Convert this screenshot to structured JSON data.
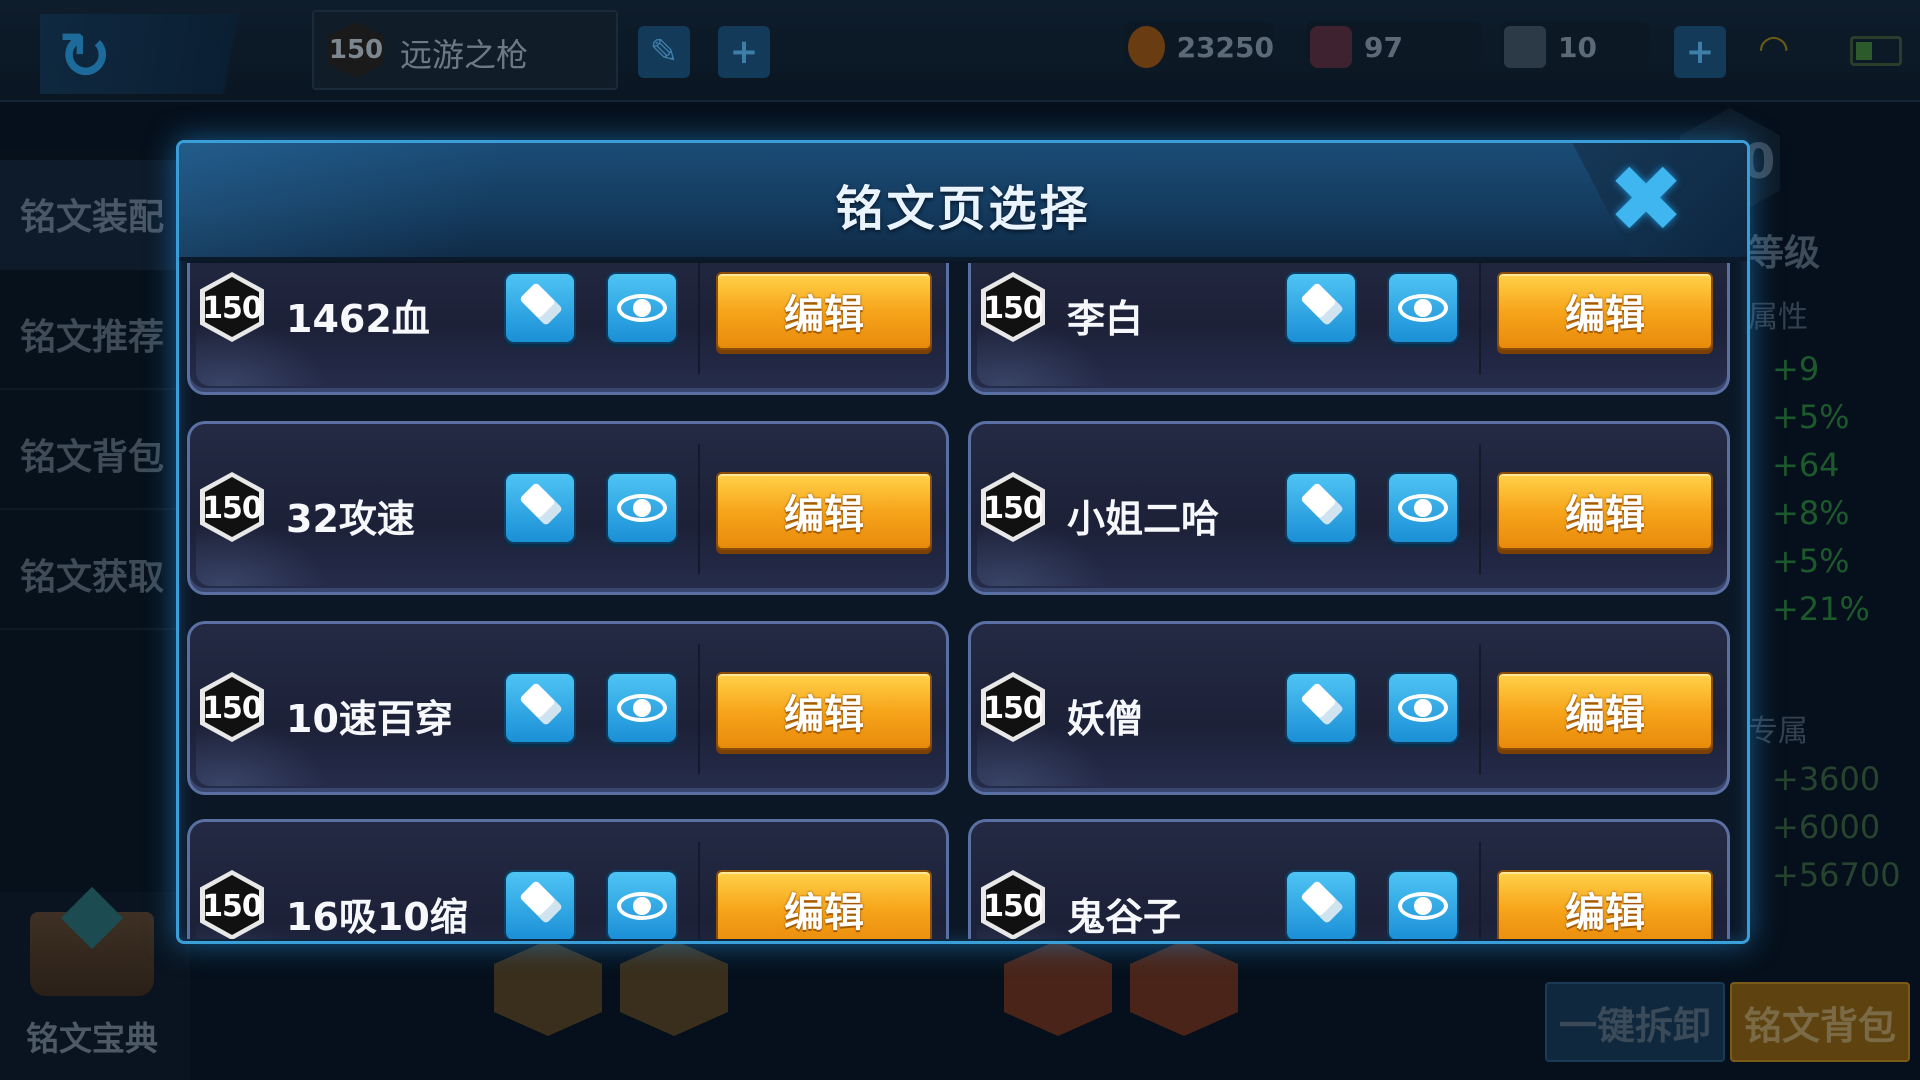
{
  "topbar": {
    "hero_level": "150",
    "hero_name": "远游之枪",
    "gold": "23250",
    "diamonds": "97",
    "coupons": "10"
  },
  "left_nav": {
    "items": [
      {
        "label": "铭文装配"
      },
      {
        "label": "铭文推荐"
      },
      {
        "label": "铭文背包"
      },
      {
        "label": "铭文获取"
      }
    ],
    "codex_label": "铭文宝典"
  },
  "right_panel": {
    "level_value": "0",
    "level_label": "等级",
    "attr_title": "属性",
    "stats": [
      "+9",
      "+5%",
      "+64",
      "+8%",
      "+5%",
      "+21%"
    ],
    "exclusive_title": "专属",
    "exclusive_stats": [
      "+3600",
      "+6000",
      "+56700"
    ]
  },
  "bottom_buttons": {
    "unequip_all": "一键拆卸",
    "rune_bag": "铭文背包"
  },
  "modal": {
    "title": "铭文页选择",
    "edit_label": "编辑",
    "pages": [
      {
        "level": "150",
        "name": "1462血"
      },
      {
        "level": "150",
        "name": "李白"
      },
      {
        "level": "150",
        "name": "32攻速"
      },
      {
        "level": "150",
        "name": "小姐二哈"
      },
      {
        "level": "150",
        "name": "10速百穿"
      },
      {
        "level": "150",
        "name": "妖僧"
      },
      {
        "level": "150",
        "name": "16吸10缩"
      },
      {
        "level": "150",
        "name": "鬼谷子"
      }
    ]
  },
  "colors": {
    "accent_blue": "#3fb6f0",
    "edit_gold": "#f7a51a",
    "card_border": "#5a6fa2"
  }
}
